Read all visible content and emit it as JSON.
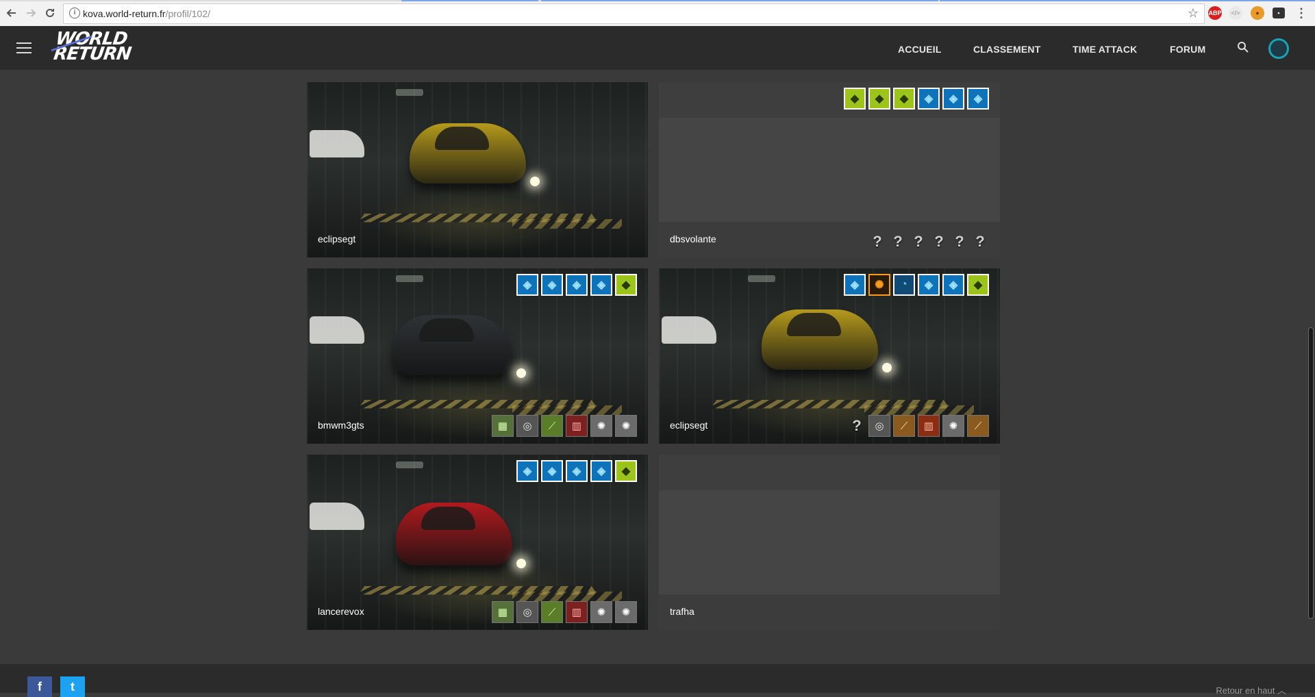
{
  "browser": {
    "url_host": "kova.world-return.fr",
    "url_path": "/profil/102/",
    "back_icon": "arrow-left-icon",
    "forward_icon": "arrow-right-icon",
    "reload_icon": "reload-icon",
    "info_icon": "info-icon",
    "star_icon": "star-icon",
    "extensions": [
      "ABP",
      "</>",
      "cookie",
      "incognito",
      "⋮"
    ]
  },
  "header": {
    "logo_line1": "WORLD",
    "logo_line2": "RETURN",
    "menu": [
      "ACCUEIL",
      "CLASSEMENT",
      "TIME ATTACK",
      "FORUM"
    ]
  },
  "cards": [
    {
      "name": "eclipsegt",
      "has_image": true,
      "car_color": "#b59a1c",
      "badges": [],
      "parts": []
    },
    {
      "name": "dbsvolante",
      "has_image": false,
      "badges": [
        "green",
        "green",
        "green",
        "blue",
        "blue",
        "blue"
      ],
      "parts": [
        "?",
        "?",
        "?",
        "?",
        "?",
        "?"
      ]
    },
    {
      "name": "bmwm3gts",
      "has_image": true,
      "car_color": "#2f3336",
      "badges": [
        "blue",
        "blue",
        "blue",
        "blue",
        "green"
      ],
      "parts": [
        "p-green",
        "p-grey",
        "p-lime",
        "p-red",
        "p-silver",
        "p-silver"
      ]
    },
    {
      "name": "eclipsegt",
      "has_image": true,
      "car_color": "#b59a1c",
      "badges": [
        "blue",
        "orange",
        "blue2",
        "blue",
        "blue",
        "green"
      ],
      "parts": [
        "?",
        "p-grey",
        "p-orange",
        "p-orange-red",
        "p-silver",
        "p-orange"
      ]
    },
    {
      "name": "lancerevox",
      "has_image": true,
      "car_color": "#b01a1e",
      "badges": [
        "blue",
        "blue",
        "blue",
        "blue",
        "green"
      ],
      "parts": [
        "p-green",
        "p-grey",
        "p-lime",
        "p-red",
        "p-silver",
        "p-silver"
      ]
    },
    {
      "name": "trafha",
      "has_image": false,
      "badges": [],
      "parts": []
    }
  ],
  "footer": {
    "facebook": "f",
    "twitter": "t",
    "back_to_top": "Retour en haut"
  }
}
